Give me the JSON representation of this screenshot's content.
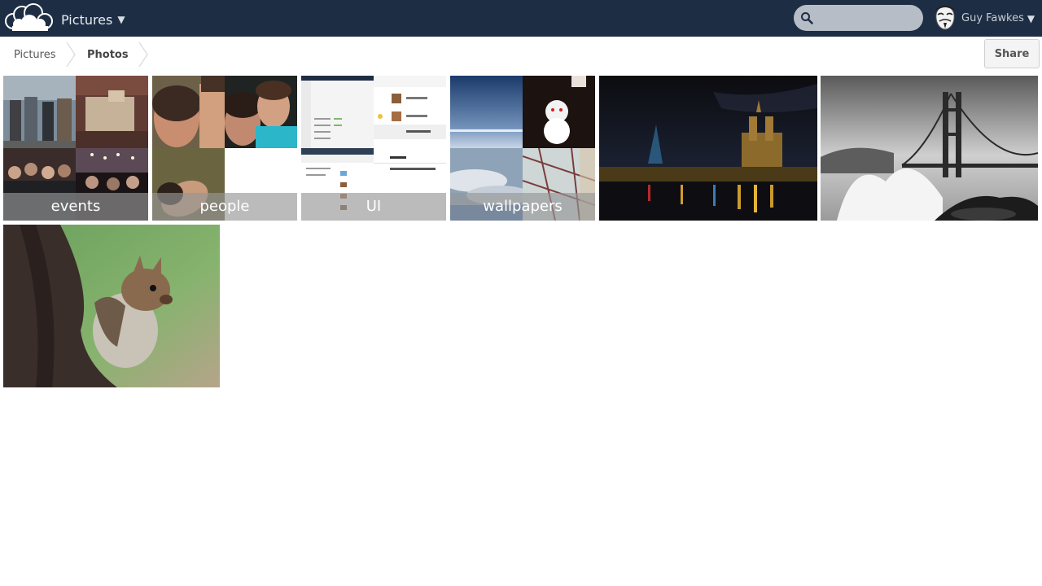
{
  "header": {
    "app_name": "Pictures",
    "caret": "▼",
    "search_placeholder": "",
    "user_name": "Guy Fawkes",
    "user_caret": "▼"
  },
  "breadcrumb": {
    "items": [
      "Pictures",
      "Photos"
    ]
  },
  "actions": {
    "share_label": "Share"
  },
  "albums": [
    {
      "label": "events"
    },
    {
      "label": "people"
    },
    {
      "label": "UI"
    },
    {
      "label": "wallpapers"
    }
  ],
  "colors": {
    "header_bg": "#1d2d44",
    "search_bg": "#b7bdc6",
    "label_overlay": "rgba(150,150,150,0.65)"
  },
  "icons": {
    "logo": "cloud-logo-icon",
    "search": "search-icon",
    "avatar": "guy-fawkes-mask-avatar"
  }
}
